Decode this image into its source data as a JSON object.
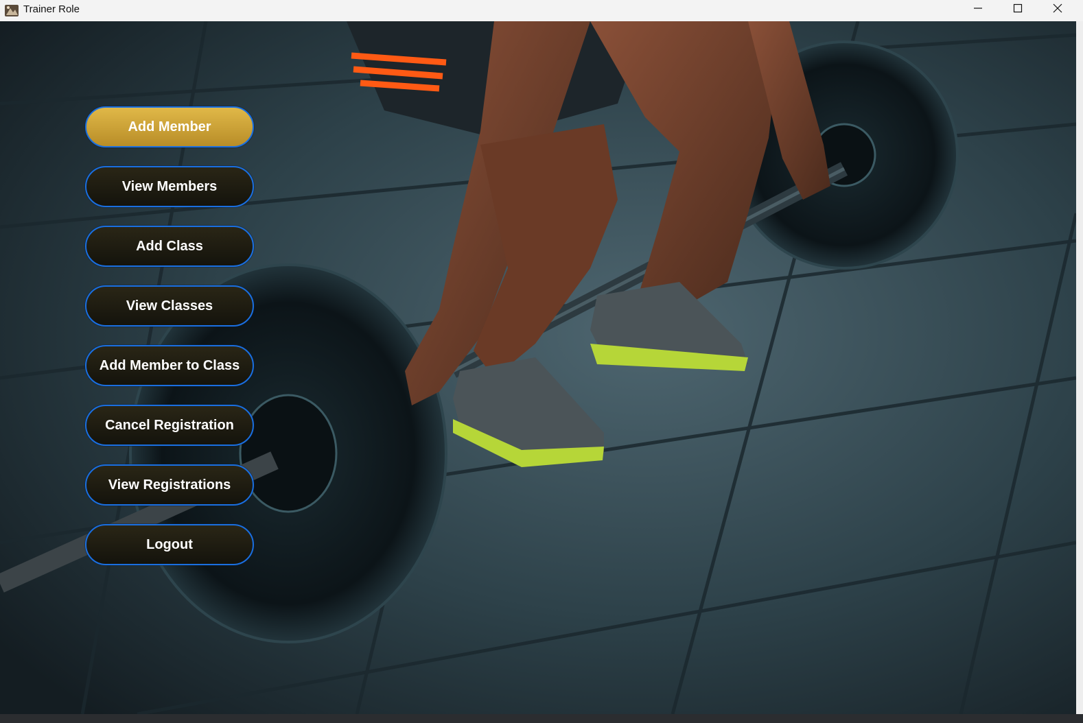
{
  "window": {
    "title": "Trainer Role",
    "icon": "app-icon"
  },
  "controls": {
    "minimize_icon": "minimize-icon",
    "maximize_icon": "maximize-icon",
    "close_icon": "close-icon"
  },
  "menu": {
    "buttons": [
      {
        "label": "Add Member",
        "active": true
      },
      {
        "label": "View Members",
        "active": false
      },
      {
        "label": "Add Class",
        "active": false
      },
      {
        "label": "View Classes",
        "active": false
      },
      {
        "label": "Add Member to Class",
        "active": false
      },
      {
        "label": "Cancel Registration",
        "active": false
      },
      {
        "label": "View Registrations",
        "active": false
      },
      {
        "label": "Logout",
        "active": false
      }
    ]
  },
  "colors": {
    "button_border": "#1a6fe0",
    "button_dark": "#1f1d12",
    "button_active": "#d4a83c",
    "button_text": "#ffffff"
  }
}
